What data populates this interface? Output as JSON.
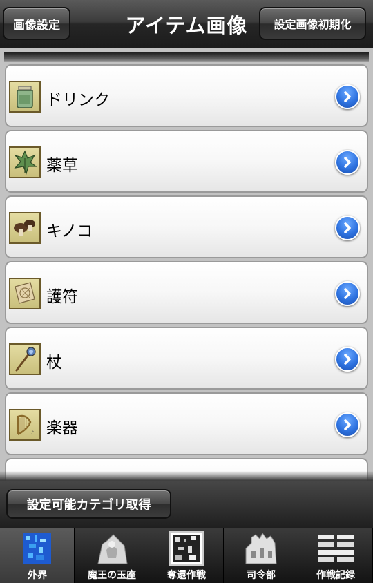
{
  "header": {
    "left_button": "画像設定",
    "title": "アイテム画像",
    "right_button": "設定画像初期化"
  },
  "items": [
    {
      "label": "ドリンク",
      "icon": "drink-jar-icon"
    },
    {
      "label": "薬草",
      "icon": "herb-leaf-icon"
    },
    {
      "label": "キノコ",
      "icon": "mushroom-icon"
    },
    {
      "label": "護符",
      "icon": "talisman-icon"
    },
    {
      "label": "杖",
      "icon": "staff-icon"
    },
    {
      "label": "楽器",
      "icon": "harp-icon"
    }
  ],
  "action": {
    "fetch_button": "設定可能カテゴリ取得"
  },
  "tabs": [
    {
      "label": "外界",
      "icon": "outer-world-icon",
      "active": true
    },
    {
      "label": "魔王の玉座",
      "icon": "demon-throne-icon",
      "active": false
    },
    {
      "label": "奪還作戦",
      "icon": "recapture-icon",
      "active": false
    },
    {
      "label": "司令部",
      "icon": "headquarters-icon",
      "active": false
    },
    {
      "label": "作戦記録",
      "icon": "operation-log-icon",
      "active": false
    }
  ],
  "colors": {
    "accent_blue": "#2f73e0",
    "thumb_bg": "#d8cf8e",
    "header_dark": "#1b1b1b"
  }
}
